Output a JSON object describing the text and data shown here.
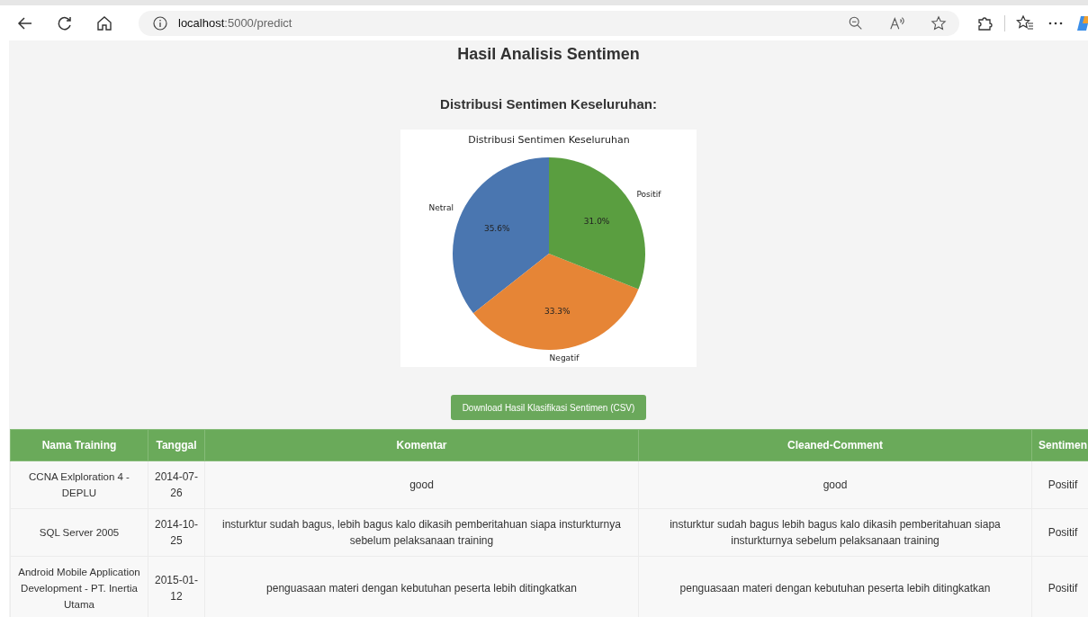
{
  "browser": {
    "address": "**localhost**:5000/predict"
  },
  "page": {
    "title": "Hasil Analisis Sentimen",
    "subtitle": "Distribusi Sentimen Keseluruhan:",
    "chart_data": {
      "type": "pie",
      "title": "Distribusi Sentimen Keseluruhan",
      "categories": [
        "Netral",
        "Negatif",
        "Positif"
      ],
      "series": [
        {
          "colors": [
            "#4a76b0",
            "#e68536",
            "#5a9e40"
          ],
          "values": [
            35.6,
            33.3,
            31.0
          ]
        }
      ],
      "value_labels": [
        "35.6%",
        "33.3%",
        "31.0%"
      ]
    },
    "download_button": "Download Hasil Klasifikasi Sentimen (CSV)"
  },
  "table": {
    "columns": [
      "Nama Training",
      "Tanggal",
      "Komentar",
      "Cleaned-Comment",
      "Sentimen"
    ],
    "rows": [
      [
        "CCNA Exlploration 4 - DEPLU",
        "2014-07-26",
        "good",
        "good",
        "Positif"
      ],
      [
        "SQL Server 2005",
        "2014-10-25",
        "insturktur sudah bagus, lebih bagus kalo dikasih pemberitahuan siapa insturkturnya sebelum pelaksanaan training",
        "insturktur sudah bagus lebih bagus kalo dikasih pemberitahuan siapa insturkturnya sebelum pelaksanaan training",
        "Positif"
      ],
      [
        "Android Mobile Application Development - PT. Inertia Utama",
        "2015-01-12",
        "penguasaan materi dengan kebutuhan peserta lebih ditingkatkan",
        "penguasaan materi dengan kebutuhan peserta lebih ditingkatkan",
        "Positif"
      ]
    ]
  }
}
